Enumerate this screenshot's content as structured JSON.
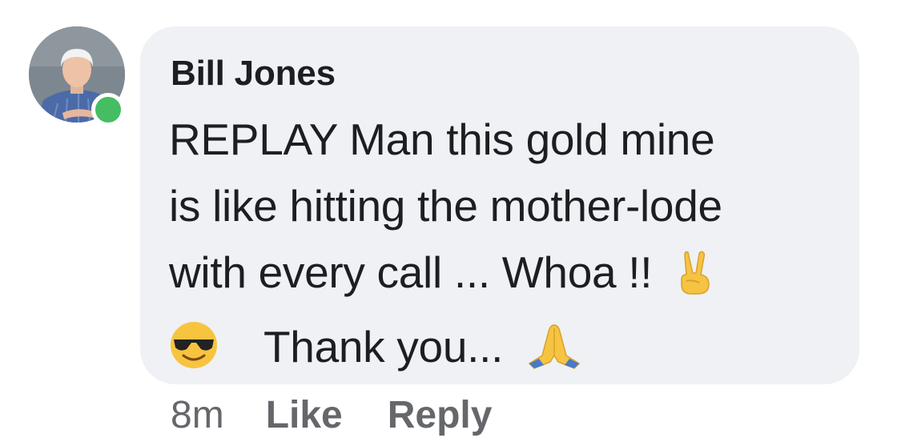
{
  "comment": {
    "author": "Bill Jones",
    "lines": [
      "REPLAY Man this gold mine",
      "is like hitting the mother-lode",
      "with every call ... Whoa !!",
      "Thank you..."
    ],
    "emojis": [
      "victory-hand-emoji",
      "sunglasses-smile-emoji",
      "folded-hands-emoji"
    ],
    "online": true
  },
  "actions": {
    "timestamp": "8m",
    "like_label": "Like",
    "reply_label": "Reply"
  },
  "colors": {
    "bubble": "#eff1f4",
    "text": "#1c1e21",
    "secondary": "#65676b",
    "presence": "#45bd62"
  }
}
